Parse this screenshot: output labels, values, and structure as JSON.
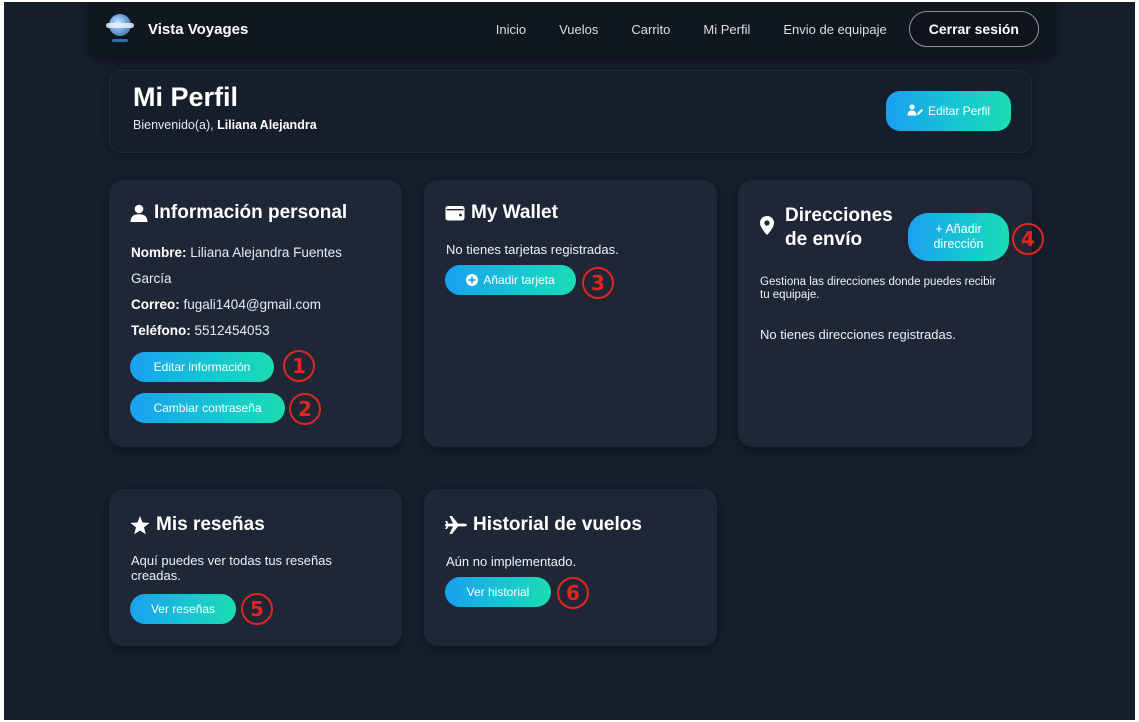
{
  "navbar": {
    "brand": "Vista Voyages",
    "links": [
      "Inicio",
      "Vuelos",
      "Carrito",
      "Mi Perfil",
      "Envio de equipaje"
    ],
    "logout_label": "Cerrar sesión"
  },
  "profile": {
    "title": "Mi Perfil",
    "welcome_prefix": "Bienvenido(a), ",
    "user_name": "Liliana Alejandra",
    "edit_profile_label": "Editar Perfil"
  },
  "personal_info": {
    "title": "Información personal",
    "name_label": "Nombre:",
    "name_value": " Liliana Alejandra Fuentes García",
    "email_label": "Correo:",
    "email_value": " fugali1404@gmail.com",
    "phone_label": "Teléfono:",
    "phone_value": " 5512454053",
    "edit_info_label": "Editar información",
    "change_password_label": "Cambiar contraseña"
  },
  "wallet": {
    "title": "My Wallet",
    "empty_text": "No tienes tarjetas registradas.",
    "add_card_label": "Añadir tarjeta"
  },
  "addresses": {
    "title_line1": "Direcciones",
    "title_line2": "de envío",
    "add_label_line1": "+ Añadir",
    "add_label_line2": "dirección",
    "description": "Gestiona las direcciones donde puedes recibir tu equipaje.",
    "empty_text": "No tienes direcciones registradas."
  },
  "reviews": {
    "title": "Mis reseñas",
    "description": "Aquí puedes ver todas tus reseñas creadas.",
    "button_label": "Ver reseñas"
  },
  "flight_history": {
    "title": "Historial de vuelos",
    "description": "Aún no implementado.",
    "button_label": "Ver historial"
  },
  "annotations": [
    "1",
    "2",
    "3",
    "4",
    "5",
    "6"
  ],
  "colors": {
    "background": "#161d2b",
    "card": "#1f2737",
    "navbar": "#111721",
    "accent_gradient_start": "#1aa0f0",
    "accent_gradient_end": "#1bdcb2",
    "marker": "#e0261f"
  }
}
